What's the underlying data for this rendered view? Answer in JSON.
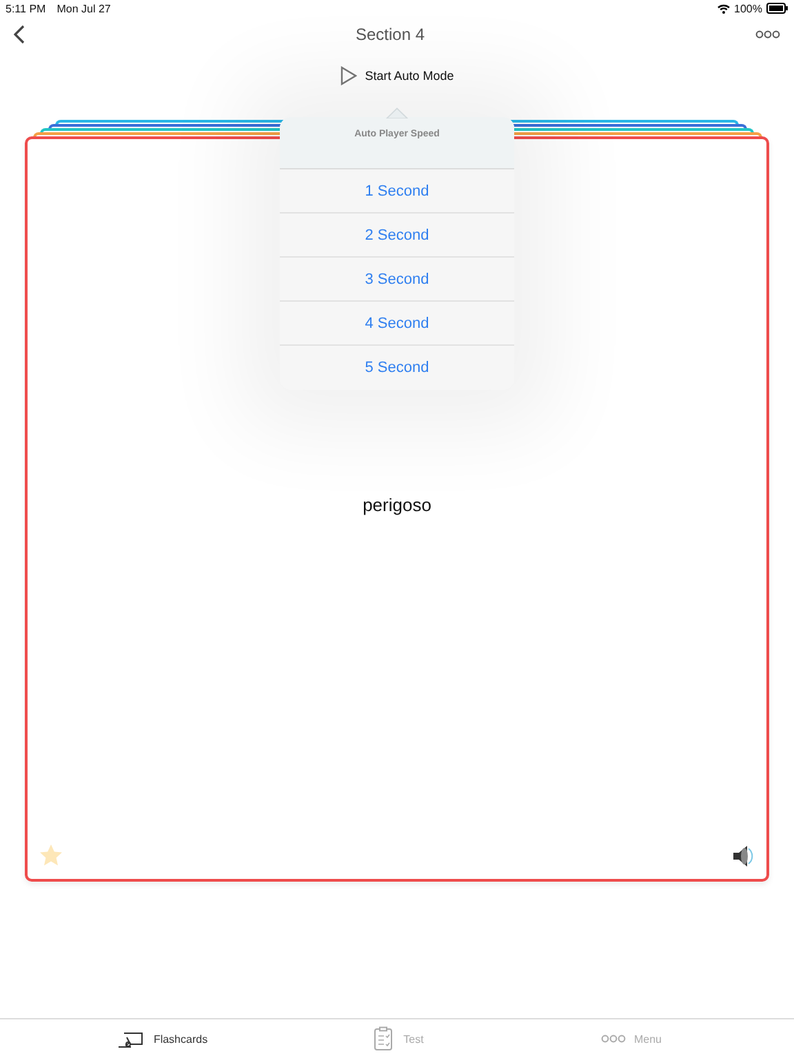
{
  "status_bar": {
    "time": "5:11 PM",
    "date": "Mon Jul 27",
    "battery": "100%"
  },
  "nav": {
    "title": "Section 4"
  },
  "auto_mode": {
    "label": "Start Auto Mode"
  },
  "card_stack": [
    {
      "color": "#29b6e6"
    },
    {
      "color": "#3a6fd8"
    },
    {
      "color": "#22c5c5"
    },
    {
      "color": "#f5a046"
    }
  ],
  "card": {
    "color": "#ee4c4c",
    "word": "perigoso",
    "starred": false
  },
  "popover": {
    "title": "Auto Player Speed",
    "options": [
      {
        "label": "1 Second",
        "selected": false
      },
      {
        "label": "2 Second",
        "selected": false
      },
      {
        "label": "3 Second",
        "selected": false
      },
      {
        "label": "4 Second",
        "selected": false
      },
      {
        "label": "5 Second",
        "selected": false
      }
    ]
  },
  "tabs": [
    {
      "kind": "flashcards",
      "label": "Flashcards",
      "selected": true
    },
    {
      "kind": "test",
      "label": "Test",
      "selected": false
    },
    {
      "kind": "menu",
      "label": "Menu",
      "selected": false
    }
  ]
}
